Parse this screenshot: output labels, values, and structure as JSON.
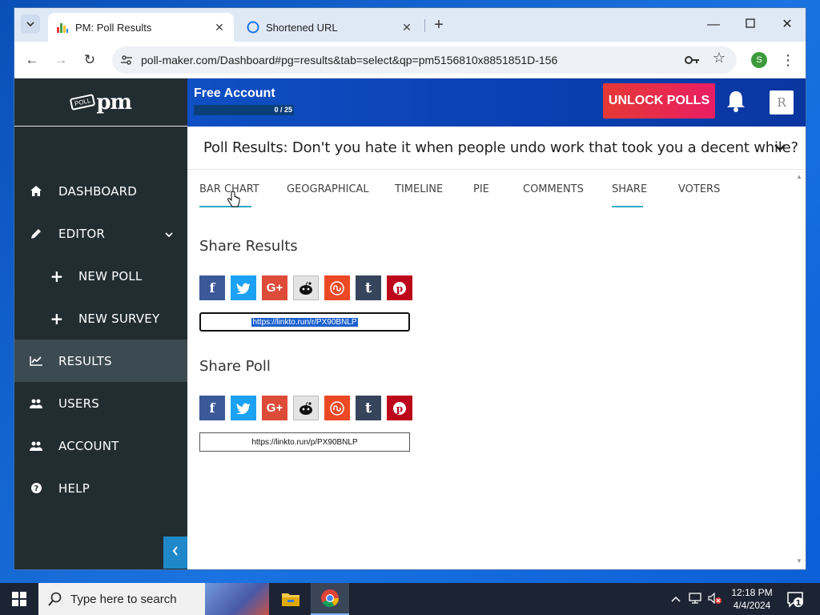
{
  "browser": {
    "tabs": [
      {
        "title": "PM: Poll Results",
        "active": true
      },
      {
        "title": "Shortened URL",
        "active": false
      }
    ],
    "new_tab": "+",
    "address": "poll-maker.com/Dashboard#pg=results&tab=select&qp=pm5156810x8851851D-156",
    "profile_initial": "S"
  },
  "app": {
    "account": {
      "title": "Free Account",
      "progress_text": "0 / 25",
      "progress_value": 0
    },
    "unlock_label": "UNLOCK POLLS",
    "avatar_initial": "R",
    "sidebar": {
      "items": [
        {
          "label": "DASHBOARD",
          "icon": "home-icon"
        },
        {
          "label": "EDITOR",
          "icon": "pencil-icon"
        },
        {
          "label": "NEW POLL",
          "icon": "plus-icon"
        },
        {
          "label": "NEW SURVEY",
          "icon": "plus-icon"
        },
        {
          "label": "RESULTS",
          "icon": "line-chart-icon",
          "active": true
        },
        {
          "label": "USERS",
          "icon": "users-icon"
        },
        {
          "label": "ACCOUNT",
          "icon": "users-icon"
        },
        {
          "label": "HELP",
          "icon": "question-icon"
        }
      ]
    },
    "poll_title": "Poll Results: Don't you hate it when people undo work that took you a decent while?",
    "result_tabs": [
      "BAR CHART",
      "GEOGRAPHICAL",
      "TIMELINE",
      "PIE",
      "COMMENTS",
      "SHARE",
      "VOTERS"
    ],
    "active_tab": "SHARE",
    "share_results": {
      "title": "Share Results",
      "link": "https://linkto.run/r/PX90BNLP"
    },
    "share_poll": {
      "title": "Share Poll",
      "link": "https://linkto.run/p/PX90BNLP"
    },
    "social": [
      "facebook",
      "twitter",
      "google-plus",
      "reddit",
      "stumbleupon",
      "tumblr",
      "pinterest"
    ],
    "social_colors": {
      "facebook": "#3b5998",
      "twitter": "#1da1f2",
      "google-plus": "#dd4b39",
      "reddit": "#e4e4e4",
      "stumbleupon": "#eb4924",
      "tumblr": "#35465c",
      "pinterest": "#bd081c"
    }
  },
  "taskbar": {
    "search_placeholder": "Type here to search",
    "time": "12:18 PM",
    "date": "4/4/2024",
    "notification_count": "1"
  }
}
